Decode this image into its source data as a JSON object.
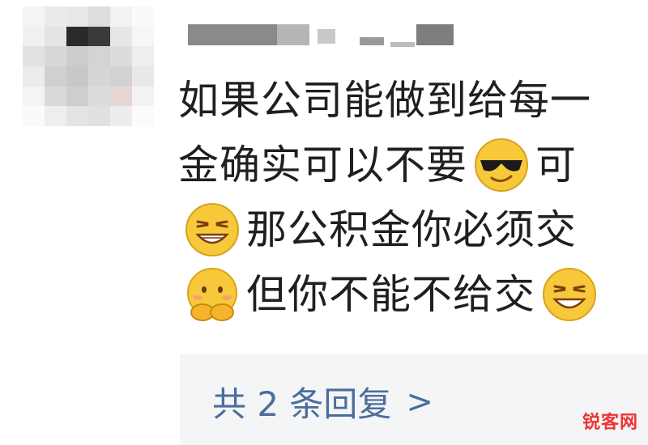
{
  "comment": {
    "lines": [
      {
        "segments": [
          {
            "text": "如果公司能做到给每一"
          }
        ]
      },
      {
        "segments": [
          {
            "text": "金确实可以不要"
          },
          {
            "emoji": "sunglasses-icon"
          },
          {
            "text": "可"
          }
        ]
      },
      {
        "segments": [
          {
            "emoji": "grin-icon"
          },
          {
            "text": "那公积金你必须交"
          }
        ]
      },
      {
        "segments": [
          {
            "emoji": "shy-cover-mouth-icon"
          },
          {
            "text": "但你不能不给交"
          },
          {
            "emoji": "grin-icon"
          }
        ]
      }
    ]
  },
  "replies": {
    "label": "共 2 条回复",
    "chevron": ">"
  },
  "watermark": {
    "text": "锐客网"
  },
  "colors": {
    "link": "#4a6e9c",
    "bar_bg": "#f4f5f7",
    "text": "#1f1f1f",
    "watermark": "#ee3333"
  }
}
